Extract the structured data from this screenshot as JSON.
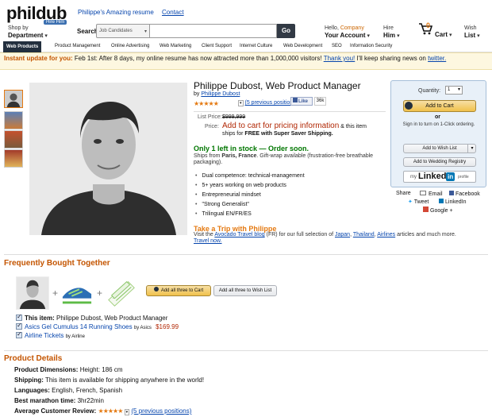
{
  "header": {
    "logo": "phildub",
    "logo_sub": "Hire Him",
    "links": [
      "Philippe's Amazing resume",
      "Contact"
    ],
    "shop_by": "Shop by",
    "department": "Department",
    "search_label": "Search",
    "search_category": "Job Candidates",
    "search_value": "",
    "search_go": "Go",
    "hello": "Hello,",
    "company": "Company",
    "your_account": "Your Account",
    "hire": "Hire",
    "him": "Him",
    "cart_count": "0",
    "cart": "Cart",
    "wish": "Wish",
    "list": "List"
  },
  "nav": [
    "Web Products",
    "Product Management",
    "Online Advertising",
    "Web Marketing",
    "Client Support",
    "Internet Culture",
    "Web Development",
    "SEO",
    "Information Security"
  ],
  "banner": {
    "highlight": "Instant update for you:",
    "text": "Feb 1st: After 8 days, my online resume has now attracted more than 1,000,000 visitors!",
    "link1": "Thank you!",
    "text2": "I'll keep sharing news on",
    "link2": "twitter."
  },
  "product": {
    "title": "Philippe Dubost, Web Product Manager",
    "by": "by",
    "author": "Philippe Dubost",
    "stars": "★★★★★",
    "reviews": "(5 previous positions)",
    "like": "Like",
    "like_count": "36k",
    "list_price_label": "List Price:",
    "list_price": "$999,999",
    "price_label": "Price:",
    "price_red": "Add to cart for pricing information",
    "price_text1": "& this item ships for",
    "price_bold": "FREE with Super Saver Shipping.",
    "stock": "Only 1 left in stock — Order soon.",
    "ships_from": "Ships from",
    "ships_place": "Paris, France",
    "ships_rest": ". Gift-wrap available (frustration-free breathable packaging).",
    "bullets": [
      "Dual competence: technical-management",
      "5+ years working on web products",
      "Entrepreneurial mindset",
      "\"Strong Generalist\"",
      "Trilingual EN/FR/ES"
    ],
    "trip_title": "Take a Trip with Philippe",
    "trip_visit": "Visit the",
    "trip_blog": "Avocado Travel blog",
    "trip_fr": "(FR) for our full selection of",
    "trip_japan": "Japan",
    "trip_thailand": "Thailand",
    "trip_airlines": "Airlines",
    "trip_rest": "articles and much more.",
    "trip_now": "Travel now."
  },
  "buybox": {
    "qty_label": "Quantity:",
    "qty": "1",
    "add_to_cart": "Add to Cart",
    "or": "or",
    "signin": "Sign in to turn on 1-Click ordering.",
    "wishlist": "Add to Wish List",
    "registry": "Add to Wedding Registry",
    "my": "my",
    "linked": "Linked",
    "in": "in",
    "profile": "profile"
  },
  "share": {
    "label": "Share",
    "email": "Email",
    "facebook": "Facebook",
    "tweet": "Tweet",
    "linkedin": "LinkedIn",
    "google": "Google +"
  },
  "frequently": {
    "title": "Frequently Bought Together",
    "add_all_cart": "Add all three to Cart",
    "add_all_wish": "Add all three to Wish List",
    "item1_label": "This item:",
    "item1": "Philippe Dubost, Web Product Manager",
    "item2": "Asics Gel Cumulus 14 Running Shoes",
    "item2_by": "by Asics",
    "item2_price": "$169.99",
    "item3": "Airline Tickets",
    "item3_by": "by Airline"
  },
  "details": {
    "title": "Product Details",
    "dimensions_label": "Product Dimensions:",
    "dimensions": "Height: 186 cm",
    "shipping_label": "Shipping:",
    "shipping": "This item is available for shipping anywhere in the world!",
    "languages_label": "Languages:",
    "languages": "English, French, Spanish",
    "marathon_label": "Best marathon time:",
    "marathon": "3hr22min",
    "review_label": "Average Customer Review:",
    "review_stars": "★★★★★",
    "review_link": "(5 previous positions)"
  },
  "colors": {
    "accent": "#e47911",
    "section": "#c45500",
    "link": "#0645ad",
    "stock": "#007600",
    "price": "#b12704"
  }
}
